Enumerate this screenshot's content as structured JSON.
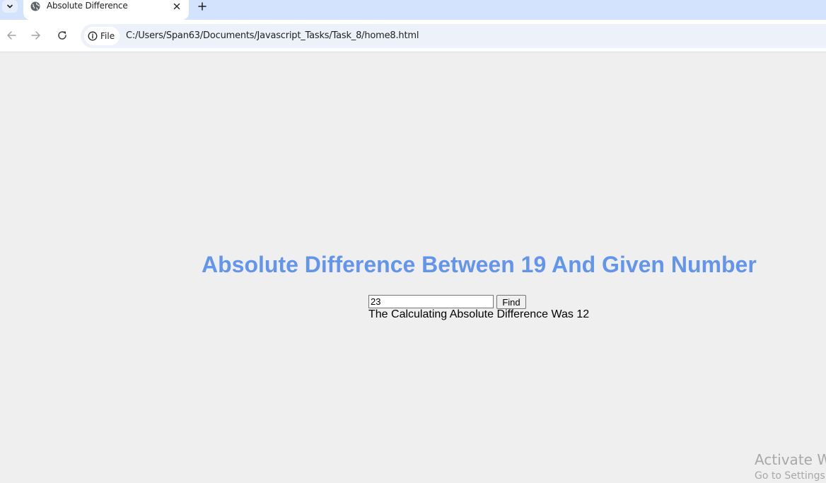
{
  "browser": {
    "tab": {
      "title": "Absolute Difference",
      "favicon": "globe-icon"
    },
    "toolbar": {
      "security_chip_label": "File",
      "url": "C:/Users/Span63/Documents/Javascript_Tasks/Task_8/home8.html"
    }
  },
  "page": {
    "heading": "Absolute Difference Between 19 And Given Number",
    "input_value": "23",
    "button_label": "Find",
    "result": "The Calculating Absolute Difference Was 12"
  },
  "watermark": {
    "title": "Activate Wi",
    "subtitle": "Go to Settings t"
  },
  "colors": {
    "heading": "#6495ed",
    "tabstrip": "#d3e3fd",
    "page_background": "#efefef"
  }
}
